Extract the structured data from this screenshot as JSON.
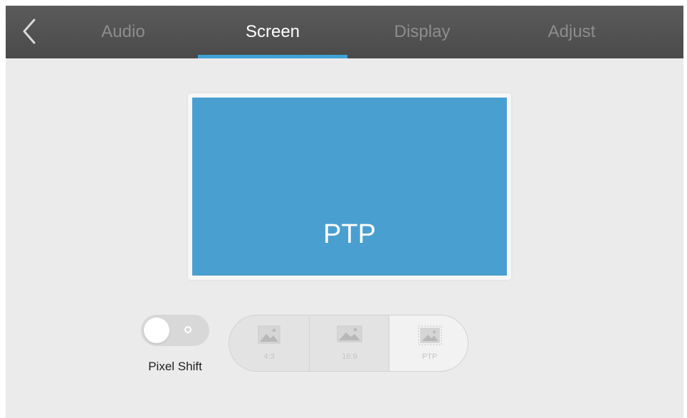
{
  "nav": {
    "back_icon": "chevron-left-icon",
    "tabs": [
      {
        "label": "Audio",
        "active": false
      },
      {
        "label": "Screen",
        "active": true
      },
      {
        "label": "Display",
        "active": false
      },
      {
        "label": "Adjust",
        "active": false
      }
    ]
  },
  "preview": {
    "label": "PTP"
  },
  "pixel_shift": {
    "label": "Pixel Shift",
    "enabled": false
  },
  "aspect": {
    "options": [
      {
        "label": "4:3",
        "icon": "image-icon",
        "selected": false
      },
      {
        "label": "16:9",
        "icon": "image-icon",
        "selected": false
      },
      {
        "label": "PTP",
        "icon": "image-icon",
        "selected": true
      }
    ]
  },
  "colors": {
    "accent": "#3fa3d6",
    "preview_fill": "#4a9fd1",
    "topbar": "#4f4f4f",
    "background": "#ebebeb"
  }
}
